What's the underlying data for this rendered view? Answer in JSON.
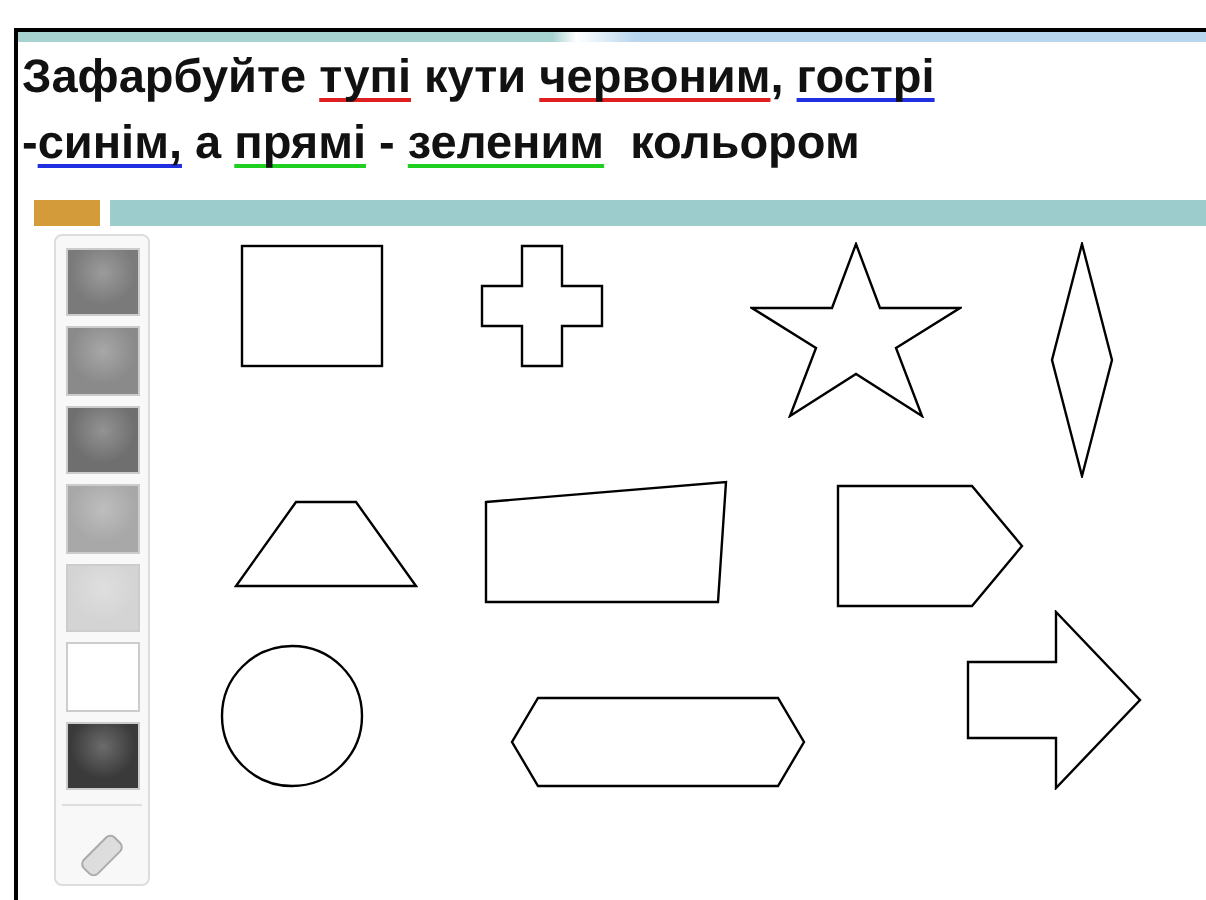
{
  "instruction": {
    "lines": [
      {
        "segments": [
          {
            "text": "Зафарбуйте "
          },
          {
            "text": "тупі",
            "color": "#e02020"
          },
          {
            "text": " кути "
          },
          {
            "text": "червоним",
            "color": "#e02020"
          },
          {
            "text": ", "
          },
          {
            "text": "гострі",
            "color": "#2030e0"
          }
        ]
      },
      {
        "segments": [
          {
            "text": "-"
          },
          {
            "text": "синім,",
            "color": "#2030e0"
          },
          {
            "text": " а "
          },
          {
            "text": "прямі",
            "color": "#20d020"
          },
          {
            "text": " - "
          },
          {
            "text": "зеленим",
            "color": "#20d020"
          },
          {
            "text": "  кольором"
          }
        ]
      }
    ]
  },
  "palette": {
    "swatches": [
      {
        "color": "#7a7a7a"
      },
      {
        "color": "#8a8a8a"
      },
      {
        "color": "#6f6f6f"
      },
      {
        "color": "#a8a8a8"
      },
      {
        "color": "#d4d4d4"
      },
      {
        "color": "#ffffff"
      },
      {
        "color": "#3a3a3a"
      }
    ]
  }
}
